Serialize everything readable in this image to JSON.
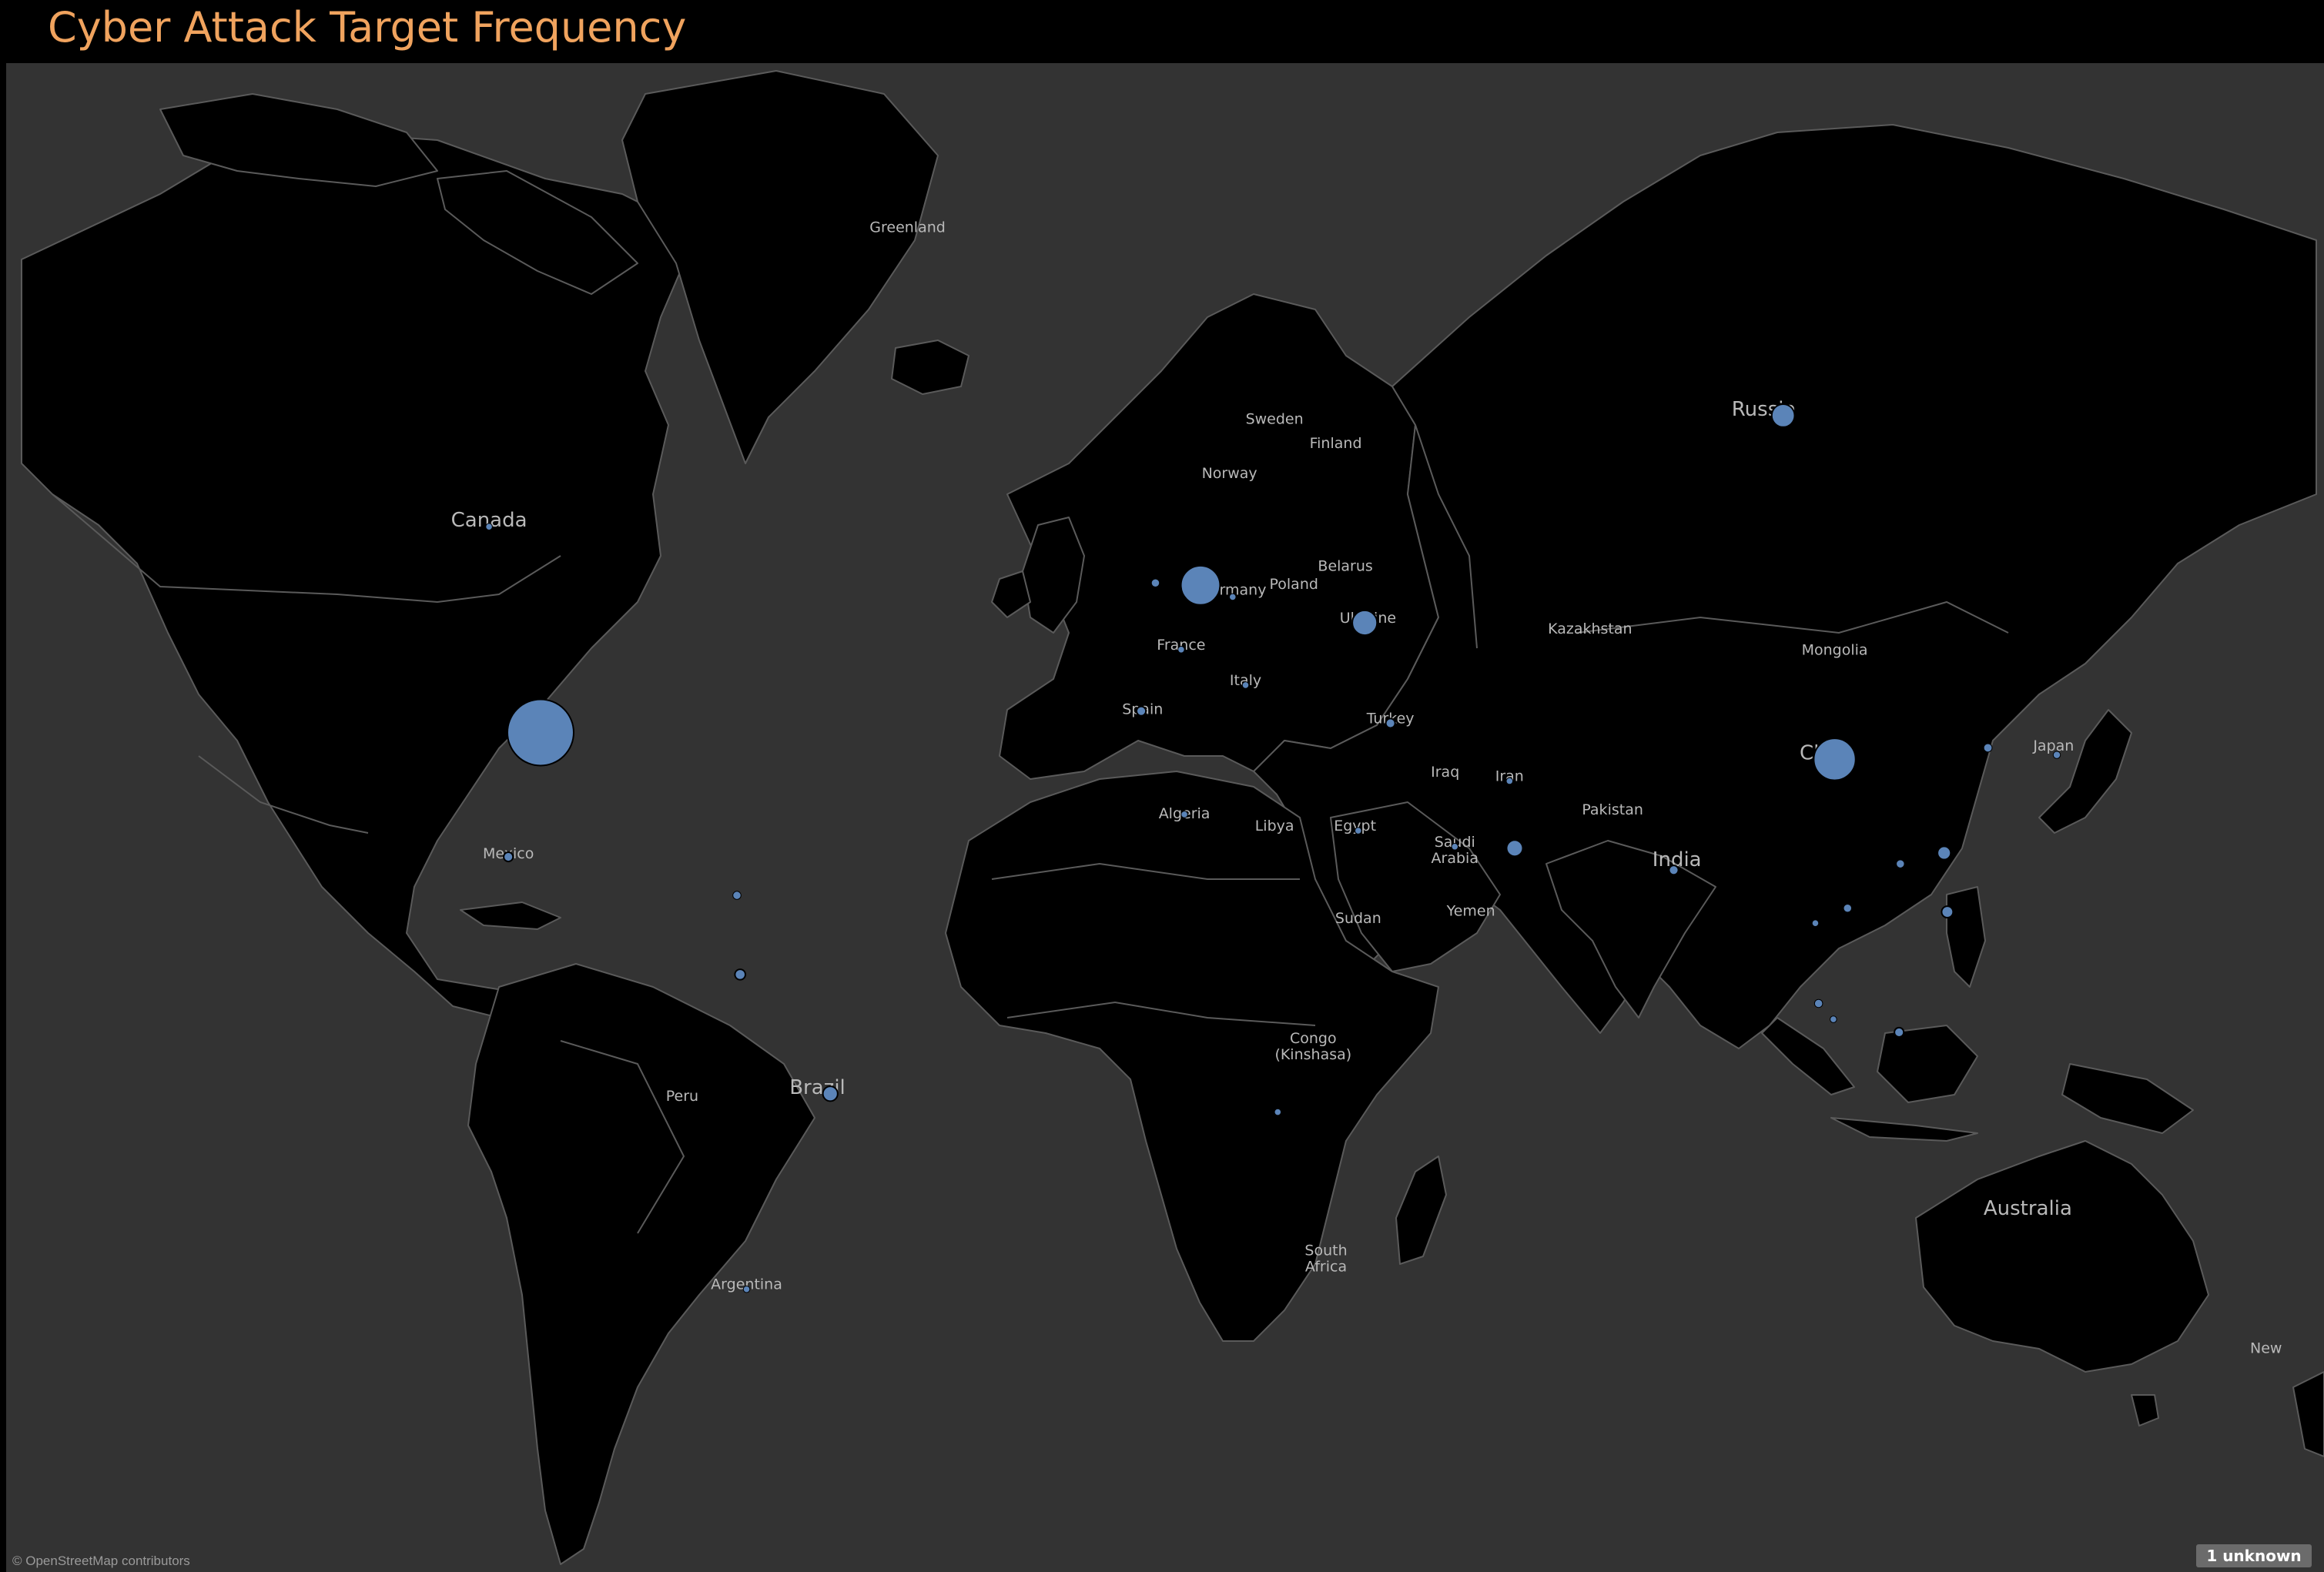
{
  "title": "Cyber Attack Target Frequency",
  "attribution": "© OpenStreetMap contributors",
  "unknown_badge": "1 unknown",
  "colors": {
    "background": "#000000",
    "ocean": "#333333",
    "land": "#000000",
    "border": "#5a5a5a",
    "marker": "#5b84b8",
    "title": "#f0a35e",
    "label": "#b9b9b9"
  },
  "country_labels": [
    {
      "name": "Greenland",
      "lon": -40,
      "lat": 73.5
    },
    {
      "name": "Canada",
      "lon": -105,
      "lat": 57
    },
    {
      "name": "Sweden",
      "lon": 17,
      "lat": 64
    },
    {
      "name": "Finland",
      "lon": 26.5,
      "lat": 62.5
    },
    {
      "name": "Norway",
      "lon": 10,
      "lat": 60.5
    },
    {
      "name": "Russia",
      "lon": 93,
      "lat": 64.5
    },
    {
      "name": "Belarus",
      "lon": 28,
      "lat": 53.5
    },
    {
      "name": "Poland",
      "lon": 20,
      "lat": 52
    },
    {
      "name": "Germany",
      "lon": 10.5,
      "lat": 51.5
    },
    {
      "name": "Ukraine",
      "lon": 31.5,
      "lat": 49
    },
    {
      "name": "Kazakhstan",
      "lon": 66,
      "lat": 48
    },
    {
      "name": "Mongolia",
      "lon": 104,
      "lat": 46
    },
    {
      "name": "France",
      "lon": 2.5,
      "lat": 46.5
    },
    {
      "name": "Italy",
      "lon": 12.5,
      "lat": 43
    },
    {
      "name": "Spain",
      "lon": -3.5,
      "lat": 40
    },
    {
      "name": "Turkey",
      "lon": 35,
      "lat": 39
    },
    {
      "name": "China",
      "lon": 103,
      "lat": 35
    },
    {
      "name": "Japan",
      "lon": 138,
      "lat": 36
    },
    {
      "name": "Iraq",
      "lon": 43.5,
      "lat": 33
    },
    {
      "name": "Iran",
      "lon": 53.5,
      "lat": 32.5
    },
    {
      "name": "Algeria",
      "lon": 3,
      "lat": 28
    },
    {
      "name": "Libya",
      "lon": 17,
      "lat": 26.5
    },
    {
      "name": "Egypt",
      "lon": 29.5,
      "lat": 26.5
    },
    {
      "name": "Saudi\nArabia",
      "lon": 45,
      "lat": 24.5
    },
    {
      "name": "Pakistan",
      "lon": 69.5,
      "lat": 28.5
    },
    {
      "name": "India",
      "lon": 79.5,
      "lat": 22
    },
    {
      "name": "Mexico",
      "lon": -102,
      "lat": 23
    },
    {
      "name": "Yemen",
      "lon": 47.5,
      "lat": 15.5
    },
    {
      "name": "Sudan",
      "lon": 30,
      "lat": 14.5
    },
    {
      "name": "Congo\n(Kinshasa)",
      "lon": 23,
      "lat": -2
    },
    {
      "name": "Peru",
      "lon": -75,
      "lat": -10
    },
    {
      "name": "Brazil",
      "lon": -54,
      "lat": -9
    },
    {
      "name": "Australia",
      "lon": 134,
      "lat": -25
    },
    {
      "name": "South\nAfrica",
      "lon": 25,
      "lat": -30
    },
    {
      "name": "Argentina",
      "lon": -65,
      "lat": -34
    },
    {
      "name": "New",
      "lon": 171,
      "lat": -41
    }
  ],
  "markers": [
    {
      "name": "United States",
      "lon": -97,
      "lat": 38,
      "size": 100
    },
    {
      "name": "Netherlands",
      "lon": 5.5,
      "lat": 52.3,
      "size": 35
    },
    {
      "name": "China",
      "lon": 104,
      "lat": 35,
      "size": 40
    },
    {
      "name": "Russia",
      "lon": 96,
      "lat": 64.5,
      "size": 12
    },
    {
      "name": "Ukraine",
      "lon": 31,
      "lat": 49,
      "size": 14
    },
    {
      "name": "Brazil",
      "lon": -52,
      "lat": -9,
      "size": 5
    },
    {
      "name": "United Arab Emirates",
      "lon": 54.3,
      "lat": 24.3,
      "size": 6
    },
    {
      "name": "Venezuela",
      "lon": -66,
      "lat": 7.5,
      "size": 2.5
    },
    {
      "name": "Philippines",
      "lon": 121.5,
      "lat": 16,
      "size": 3
    },
    {
      "name": "Taiwan",
      "lon": 121,
      "lat": 23.7,
      "size": 4
    },
    {
      "name": "South Korea",
      "lon": 127.8,
      "lat": 36.3,
      "size": 1.6
    },
    {
      "name": "Japan",
      "lon": 138.5,
      "lat": 35.5,
      "size": 1.2
    },
    {
      "name": "Indonesia",
      "lon": 114,
      "lat": -0.5,
      "size": 2
    },
    {
      "name": "Malaysia",
      "lon": 101.5,
      "lat": 3.5,
      "size": 1.5
    },
    {
      "name": "Singapore",
      "lon": 103.8,
      "lat": 1.3,
      "size": 1
    },
    {
      "name": "Thailand",
      "lon": 101,
      "lat": 14.5,
      "size": 1
    },
    {
      "name": "Vietnam",
      "lon": 106,
      "lat": 16.5,
      "size": 1.5
    },
    {
      "name": "Hong Kong",
      "lon": 114.2,
      "lat": 22.3,
      "size": 1.5
    },
    {
      "name": "India",
      "lon": 79,
      "lat": 21.5,
      "size": 2
    },
    {
      "name": "Turkey",
      "lon": 35,
      "lat": 39,
      "size": 2
    },
    {
      "name": "Spain",
      "lon": -3.7,
      "lat": 40.3,
      "size": 2
    },
    {
      "name": "United Kingdom",
      "lon": -1.5,
      "lat": 52.5,
      "size": 1.5
    },
    {
      "name": "Mexico",
      "lon": -102,
      "lat": 23.2,
      "size": 2
    },
    {
      "name": "Puerto Rico",
      "lon": -66.5,
      "lat": 18.2,
      "size": 1.5
    },
    {
      "name": "Angola",
      "lon": 17.5,
      "lat": -11.5,
      "size": 1
    },
    {
      "name": "Argentina",
      "lon": -65,
      "lat": -34,
      "size": 1
    },
    {
      "name": "Canada",
      "lon": -105,
      "lat": 57,
      "size": 1
    },
    {
      "name": "France",
      "lon": 2.5,
      "lat": 46.5,
      "size": 1
    },
    {
      "name": "Italy",
      "lon": 12.5,
      "lat": 43,
      "size": 1
    },
    {
      "name": "Egypt",
      "lon": 30,
      "lat": 26.5,
      "size": 1
    },
    {
      "name": "Saudi Arabia",
      "lon": 45,
      "lat": 24.5,
      "size": 1
    },
    {
      "name": "Iran",
      "lon": 53.5,
      "lat": 32.5,
      "size": 1
    },
    {
      "name": "Algeria",
      "lon": 3,
      "lat": 28.5,
      "size": 1
    },
    {
      "name": "Germany",
      "lon": 10.5,
      "lat": 51.3,
      "size": 1
    }
  ]
}
